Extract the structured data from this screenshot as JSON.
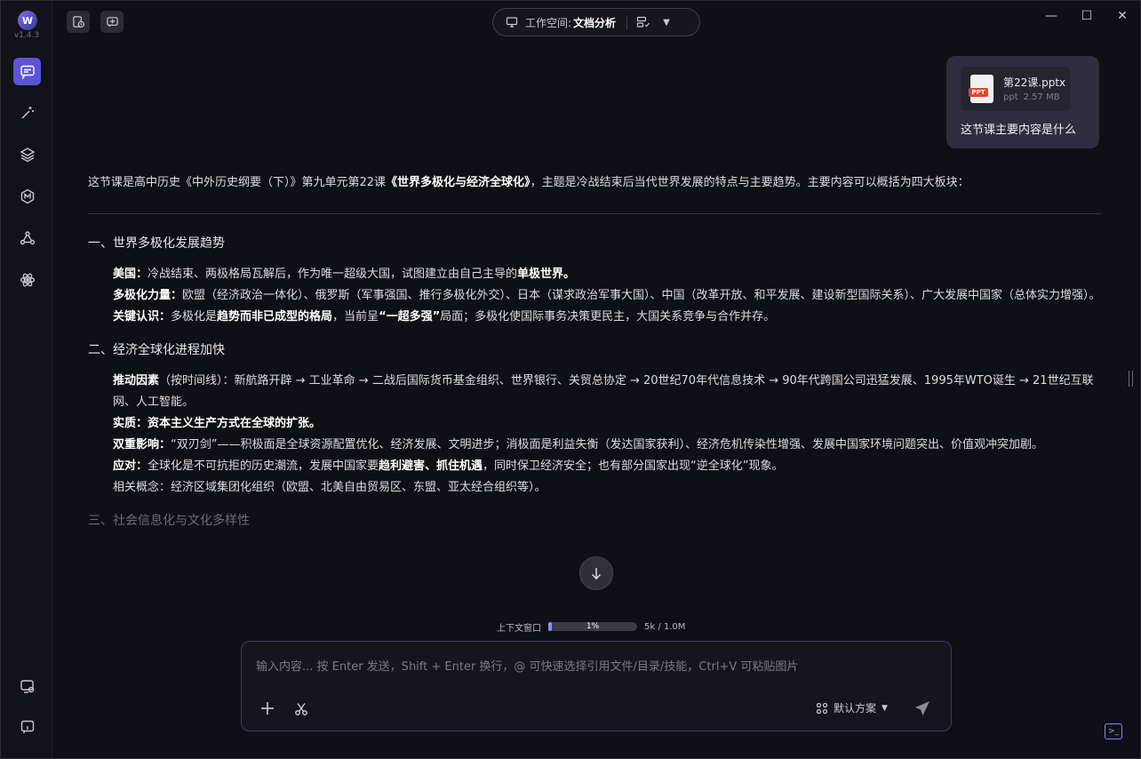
{
  "app": {
    "version": "v1.4.3",
    "logo_letter": "W"
  },
  "sidebar": {
    "items": [
      {
        "name": "chat",
        "icon": "chat-icon",
        "active": true
      },
      {
        "name": "magic",
        "icon": "magic-wand-icon",
        "active": false
      },
      {
        "name": "layers",
        "icon": "layers-icon",
        "active": false
      },
      {
        "name": "mcp",
        "icon": "mcp-icon",
        "active": false
      },
      {
        "name": "network",
        "icon": "network-icon",
        "active": false
      },
      {
        "name": "atom",
        "icon": "atom-icon",
        "active": false
      }
    ],
    "bottom": [
      {
        "name": "settings",
        "icon": "settings-icon"
      },
      {
        "name": "info",
        "icon": "info-icon"
      }
    ]
  },
  "topbar": {
    "workspace_label": "工作空间:",
    "workspace_value": "文档分析"
  },
  "user_message": {
    "file_name": "第22课.pptx",
    "file_type": "ppt",
    "file_size": "2.57 MB",
    "file_tag": "PPT",
    "text": "这节课主要内容是什么"
  },
  "answer": {
    "intro_a": "这节课是高中历史《中外历史纲要（下）》第九单元第22课",
    "intro_b": "《世界多极化与经济全球化》",
    "intro_c": "，主题是冷战结束后当代世界发展的特点与主要趋势。主要内容可以概括为四大板块：",
    "s1_title": "一、世界多极化发展趋势",
    "s1_i1_label": "美国：",
    "s1_i1_text": "冷战结束、两极格局瓦解后，作为唯一超级大国，试图建立由自己主导的",
    "s1_i1_bold": "单极世界。",
    "s1_i2_label": "多极化力量：",
    "s1_i2_text": "欧盟（经济政治一体化）、俄罗斯（军事强国、推行多极化外交）、日本（谋求政治军事大国）、中国（改革开放、和平发展、建设新型国际关系）、广大发展中国家（总体实力增强）。",
    "s1_i3_label": "关键认识：",
    "s1_i3_a": "多极化是",
    "s1_i3_bold": "趋势而非已成型的格局",
    "s1_i3_b": "，当前呈",
    "s1_i3_bold2": "“一超多强”",
    "s1_i3_c": "局面；多极化使国际事务决策更民主，大国关系竞争与合作并存。",
    "s2_title": "二、经济全球化进程加快",
    "s2_i1_label": "推动因素",
    "s2_i1_text": "（按时间线）：新航路开辟 → 工业革命 → 二战后国际货币基金组织、世界银行、关贸总协定 → 20世纪70年代信息技术 → 90年代跨国公司迅猛发展、1995年WTO诞生 → 21世纪互联网、人工智能。",
    "s2_i2_label": "实质：",
    "s2_i2_bold": "资本主义生产方式在全球的扩张。",
    "s2_i3_label": "双重影响：",
    "s2_i3_text": "“双刃剑”——积极面是全球资源配置优化、经济发展、文明进步；消极面是利益失衡（发达国家获利）、经济危机传染性增强、发展中国家环境问题突出、价值观冲突加剧。",
    "s2_i4_label": "应对：",
    "s2_i4_a": "全球化是不可抗拒的历史潮流，发展中国家要",
    "s2_i4_bold": "趋利避害、抓住机遇",
    "s2_i4_b": "，同时保卫经济安全；也有部分国家出现“逆全球化”现象。",
    "s2_i5_text": "相关概念：经济区域集团化组织（欧盟、北美自由贸易区、东盟、亚太经合组织等）。",
    "s3_title": "三、社会信息化与文化多样性"
  },
  "context": {
    "label": "上下文窗口",
    "percent": "1%",
    "percent_value": 0.01,
    "size": "5k / 1.0M"
  },
  "input": {
    "placeholder": "输入内容... 按 Enter 发送，Shift + Enter 换行，@ 可快速选择引用文件/目录/技能，Ctrl+V 可粘贴图片",
    "plan_label": "默认方案"
  },
  "colors": {
    "accent": "#5b54d6",
    "background": "#0f1015",
    "user_bubble": "#2d2f3f"
  }
}
